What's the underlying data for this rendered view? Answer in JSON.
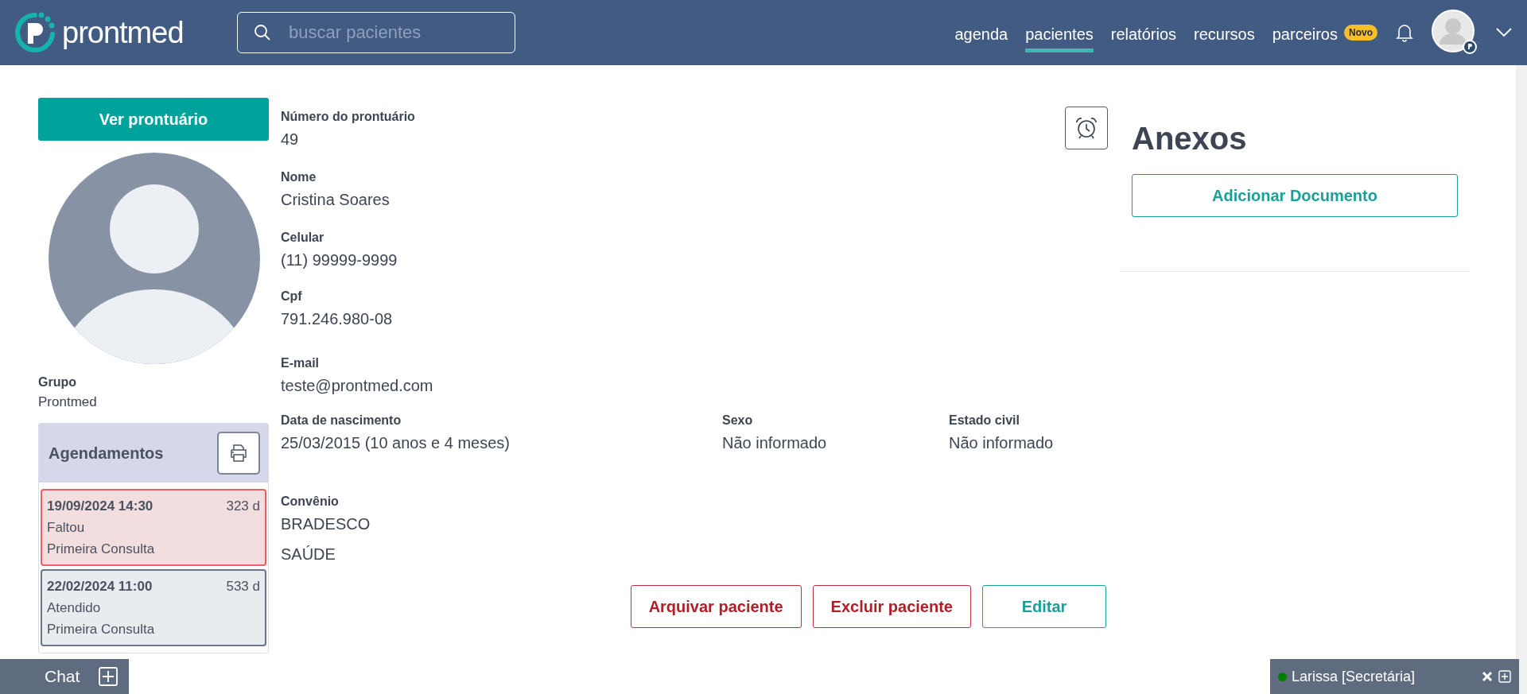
{
  "header": {
    "logo": "prontmed",
    "search": {
      "placeholder": "buscar pacientes"
    },
    "nav": [
      {
        "label": "agenda",
        "selected": false
      },
      {
        "label": "pacientes",
        "selected": true
      },
      {
        "label": "relatórios",
        "selected": false
      },
      {
        "label": "recursos",
        "selected": false
      },
      {
        "label": "parceiros",
        "selected": false,
        "badge": "Novo"
      }
    ]
  },
  "patient": {
    "record_button": "Ver prontuário",
    "group_label": "Grupo",
    "group_value": "Prontmed"
  },
  "appointments": {
    "title": "Agendamentos",
    "items": [
      {
        "datetime": "19/09/2024 14:30",
        "days": "323 d",
        "status": "Faltou",
        "type": "Primeira Consulta",
        "kind": "missed"
      },
      {
        "datetime": "22/02/2024 11:00",
        "days": "533 d",
        "status": "Atendido",
        "type": "Primeira Consulta",
        "kind": "done"
      }
    ]
  },
  "fields": [
    [
      {
        "label": "Número do prontuário",
        "value": "49"
      }
    ],
    [
      {
        "label": "Nome",
        "value": "Cristina Soares"
      }
    ],
    [
      {
        "label": "Celular",
        "value": "(11) 99999-9999"
      }
    ],
    [
      {
        "label": "Cpf",
        "value": "791.246.980-08"
      }
    ],
    [
      {
        "label": "E-mail",
        "value": "teste@prontmed.com"
      }
    ],
    [
      {
        "label": "Data de nascimento",
        "value": "25/03/2015 (10 anos e 4 meses)"
      },
      {
        "label": "Sexo",
        "value": "Não informado"
      },
      {
        "label": "Estado civil",
        "value": "Não informado"
      }
    ],
    [
      {
        "label": "Convênio",
        "value": "BRADESCO\nSAÚDE"
      }
    ]
  ],
  "actions": [
    {
      "label": "Arquivar paciente",
      "kind": "danger"
    },
    {
      "label": "Excluir paciente",
      "kind": "danger"
    },
    {
      "label": "Editar",
      "kind": "primary"
    }
  ],
  "attachments": {
    "title": "Anexos",
    "add_button": "Adicionar Documento"
  },
  "chat": {
    "label": "Chat"
  },
  "user_status": {
    "name": "Larissa [Secretária]",
    "color": "#008000"
  }
}
